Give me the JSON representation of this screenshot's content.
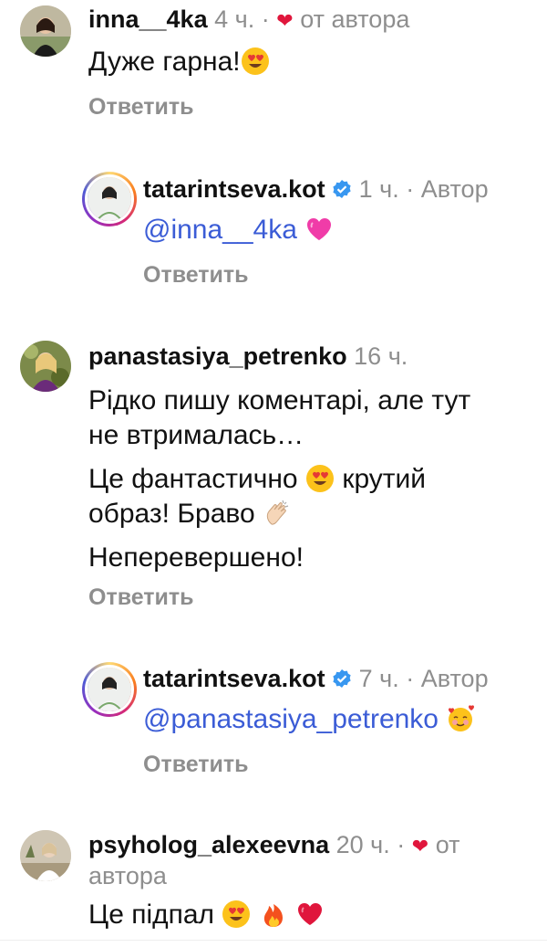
{
  "comments": [
    {
      "username": "inna__4ka",
      "time": "4 ч.",
      "sep": "·",
      "liked_label": "от автора",
      "lines": [
        "Дуже гарна!"
      ],
      "reply_label": "Ответить"
    },
    {
      "username": "tatarintseva.kot",
      "time": "1 ч.",
      "sep": "·",
      "role": "Автор",
      "mention": "@inna__4ka",
      "reply_label": "Ответить"
    },
    {
      "username": "panastasiya_petrenko",
      "time": "16 ч.",
      "lines": [
        "Рідко пишу коментарі, але тут",
        "не втрималась…",
        "Це фантастично",
        "крутий",
        "образ! Браво",
        "Неперевершено!"
      ],
      "reply_label": "Ответить"
    },
    {
      "username": "tatarintseva.kot",
      "time": "7 ч.",
      "sep": "·",
      "role": "Автор",
      "mention": "@panastasiya_petrenko",
      "reply_label": "Ответить"
    },
    {
      "username": "psyholog_alexeevna",
      "time": "20 ч.",
      "sep": "·",
      "liked_label_1": "от",
      "liked_label_2": "автора",
      "lines": [
        "Це підпал"
      ]
    }
  ],
  "colors": {
    "mention": "#3b5cd6",
    "heart": "#e0163c",
    "verified": "#3897f0",
    "secondary": "#8e8e8e"
  },
  "icons": [
    "heart-icon",
    "verified-badge-icon",
    "heart-eyes-emoji",
    "pink-heart-emoji",
    "clapping-hands-emoji",
    "smiling-hearts-emoji",
    "fire-emoji",
    "red-heart-emoji"
  ]
}
